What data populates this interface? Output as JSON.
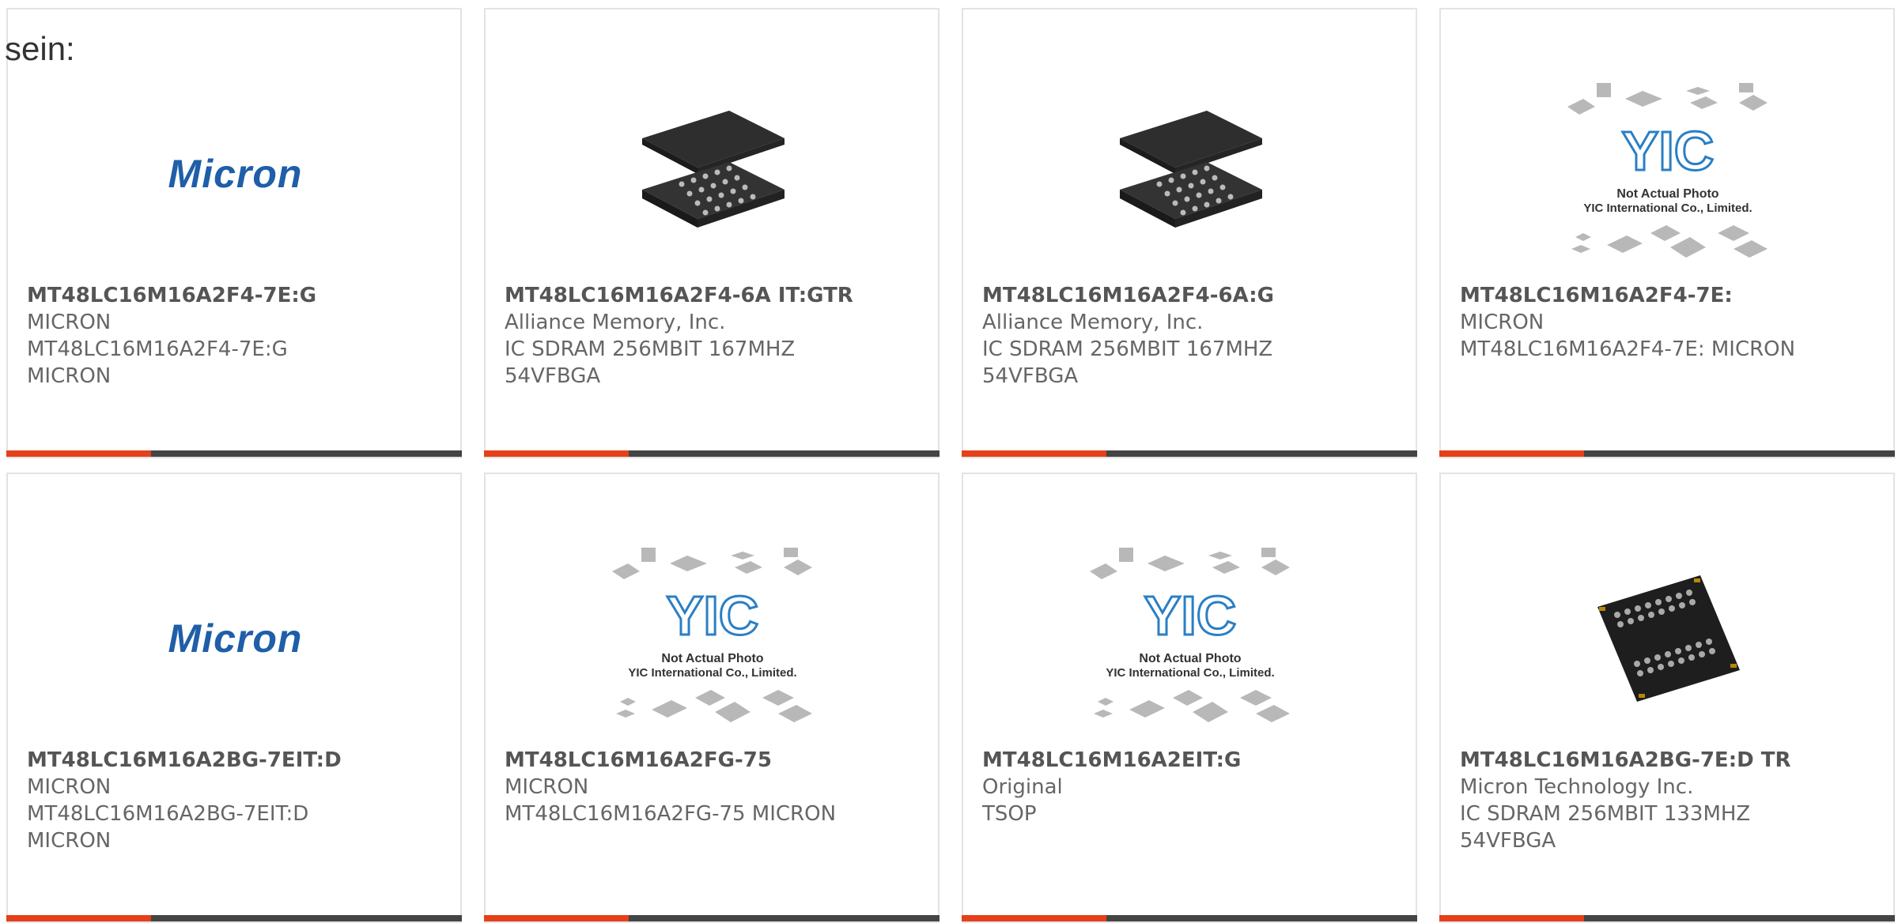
{
  "heading": "sein:",
  "cards": [
    {
      "part": "MT48LC16M16A2F4-7E:G",
      "lines": [
        "MICRON",
        "MT48LC16M16A2F4-7E:G",
        "MICRON"
      ],
      "image": "micron-logo",
      "logo_text": "Micron"
    },
    {
      "part": "MT48LC16M16A2F4-6A IT:GTR",
      "lines": [
        "Alliance Memory, Inc.",
        "IC SDRAM 256MBIT 167MHZ",
        "54VFBGA"
      ],
      "image": "bga-chip-photo"
    },
    {
      "part": "MT48LC16M16A2F4-6A:G",
      "lines": [
        "Alliance Memory, Inc.",
        "IC SDRAM 256MBIT 167MHZ",
        "54VFBGA"
      ],
      "image": "bga-chip-photo"
    },
    {
      "part": "MT48LC16M16A2F4-7E:",
      "lines": [
        "MICRON",
        "MT48LC16M16A2F4-7E: MICRON"
      ],
      "image": "yic-placeholder",
      "placeholder_lines": [
        "Not Actual Photo",
        "YIC International Co., Limited."
      ]
    },
    {
      "part": "MT48LC16M16A2BG-7EIT:D",
      "lines": [
        "MICRON",
        "MT48LC16M16A2BG-7EIT:D",
        "MICRON"
      ],
      "image": "micron-logo",
      "logo_text": "Micron"
    },
    {
      "part": "MT48LC16M16A2FG-75",
      "lines": [
        "MICRON",
        "MT48LC16M16A2FG-75 MICRON"
      ],
      "image": "yic-placeholder",
      "placeholder_lines": [
        "Not Actual Photo",
        "YIC International Co., Limited."
      ]
    },
    {
      "part": "MT48LC16M16A2EIT:G",
      "lines": [
        "Original",
        "TSOP"
      ],
      "image": "yic-placeholder",
      "placeholder_lines": [
        "Not Actual Photo",
        "YIC International Co., Limited."
      ]
    },
    {
      "part": "MT48LC16M16A2BG-7E:D TR",
      "lines": [
        "Micron Technology Inc.",
        "IC SDRAM 256MBIT 133MHZ",
        "54VFBGA"
      ],
      "image": "bga-chip-top-photo"
    }
  ],
  "colors": {
    "accent_bar": "#e5401a",
    "bar_dark": "#444444",
    "micron_blue": "#1f5ea8",
    "yic_blue": "#2a7fc4"
  }
}
